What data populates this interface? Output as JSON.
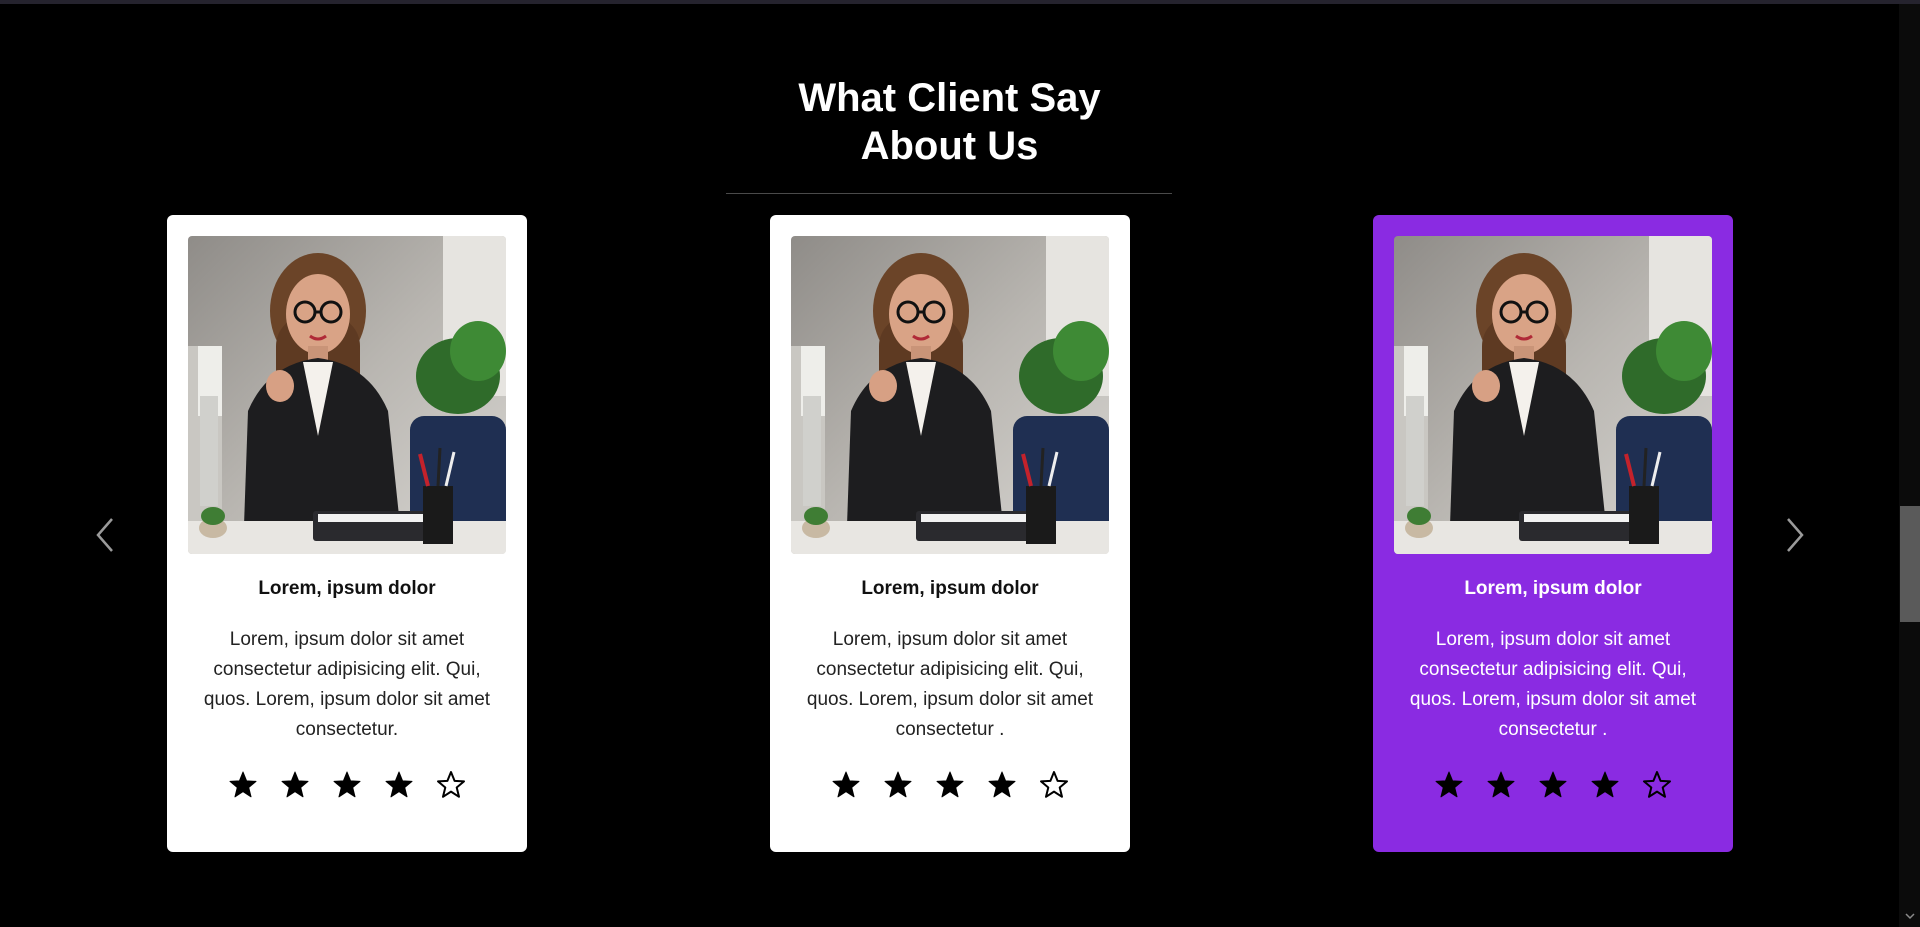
{
  "section": {
    "title_line1": "What Client Say",
    "title_line2": "About Us"
  },
  "testimonials": [
    {
      "name": "Lorem, ipsum dolor",
      "text": "Lorem, ipsum dolor sit amet consectetur adipisicing elit. Qui, quos. Lorem, ipsum dolor sit amet consectetur.",
      "rating": 4,
      "max_rating": 5,
      "highlighted": false
    },
    {
      "name": "Lorem, ipsum dolor",
      "text": "Lorem, ipsum dolor sit amet consectetur adipisicing elit. Qui, quos. Lorem, ipsum dolor sit amet consectetur .",
      "rating": 4,
      "max_rating": 5,
      "highlighted": false
    },
    {
      "name": "Lorem, ipsum dolor",
      "text": "Lorem, ipsum dolor sit amet consectetur adipisicing elit. Qui, quos. Lorem, ipsum dolor sit amet consectetur .",
      "rating": 4,
      "max_rating": 5,
      "highlighted": true
    }
  ],
  "navigation": {
    "prev_icon": "chevron-left-icon",
    "next_icon": "chevron-right-icon"
  },
  "colors": {
    "background": "#000000",
    "card": "#ffffff",
    "highlight": "#8a2be2",
    "star": "#000000"
  }
}
